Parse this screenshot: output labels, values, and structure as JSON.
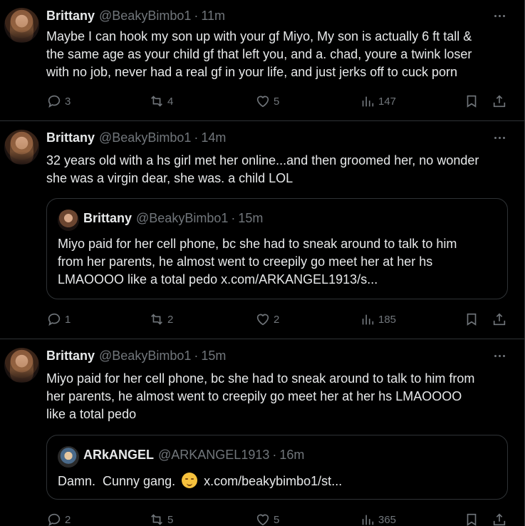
{
  "tweets": [
    {
      "name": "Brittany",
      "handle": "@BeakyBimbo1",
      "dot": "·",
      "time": "11m",
      "text": "Maybe I can hook my son up with your gf Miyo, My son is actually 6 ft tall &\nthe same age as your child gf that left you, and a. chad, youre a twink loser\nwith no job, never had a real gf in your life, and just jerks off to cuck porn",
      "replies": "3",
      "reposts": "4",
      "likes": "5",
      "views": "147"
    },
    {
      "name": "Brittany",
      "handle": "@BeakyBimbo1",
      "dot": "·",
      "time": "14m",
      "text": "32 years old with a hs girl met her online...and then groomed her, no wonder\nshe was a virgin dear, she was. a child LOL",
      "quote": {
        "name": "Brittany",
        "handle": "@BeakyBimbo1",
        "dot": "·",
        "time": "15m",
        "text": "Miyo paid for her cell phone, bc she had to sneak around to talk to him\nfrom her parents, he almost went to creepily go meet her at her hs\nLMAOOOO like a total pedo x.com/ARKANGEL1913/s..."
      },
      "replies": "1",
      "reposts": "2",
      "likes": "2",
      "views": "185"
    },
    {
      "name": "Brittany",
      "handle": "@BeakyBimbo1",
      "dot": "·",
      "time": "15m",
      "text": "Miyo paid for her cell phone, bc she had to sneak around to talk to him from\nher parents, he almost went to creepily go meet her at her hs LMAOOOO\nlike a total pedo",
      "quote": {
        "name": "ARkANGEL",
        "handle": "@ARKANGEL1913",
        "dot": "·",
        "time": "16m",
        "text_before": "Damn.  Cunny gang. ",
        "emoji": "relieved-face-emoji",
        "text_after": " x.com/beakybimbo1/st..."
      },
      "replies": "2",
      "reposts": "5",
      "likes": "5",
      "views": "365"
    }
  ],
  "icons": {
    "reply": "reply-icon",
    "repost": "repost-icon",
    "like": "heart-icon",
    "views": "views-icon",
    "bookmark": "bookmark-icon",
    "share": "share-icon",
    "more": "more-icon"
  }
}
